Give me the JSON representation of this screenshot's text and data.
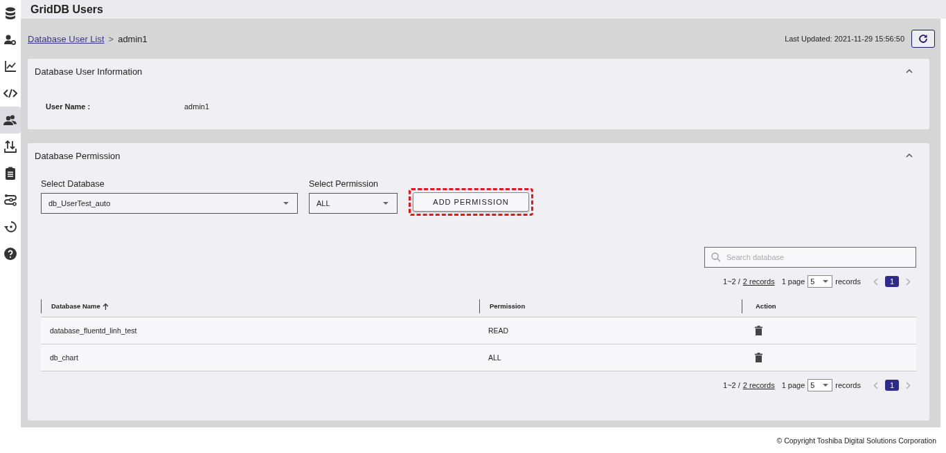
{
  "sidebar": {
    "items": [
      {
        "selected": false
      },
      {
        "selected": false
      },
      {
        "selected": false
      },
      {
        "selected": false
      },
      {
        "selected": true
      },
      {
        "selected": false
      },
      {
        "selected": false
      },
      {
        "selected": false
      },
      {
        "selected": false
      },
      {
        "selected": false
      }
    ]
  },
  "header": {
    "title": "GridDB Users"
  },
  "breadcrumb": {
    "link": "Database User List",
    "separator": ">",
    "current": "admin1"
  },
  "last_updated": "Last Updated: 2021-11-29 15:56:50",
  "user_info": {
    "title": "Database User Information",
    "expanded": true,
    "label": "User Name :",
    "value": "admin1"
  },
  "permission": {
    "title": "Database Permission",
    "expanded": true,
    "select_database": {
      "label": "Select Database",
      "value": "db_UserTest_auto"
    },
    "select_permission": {
      "label": "Select Permission",
      "value": "ALL"
    },
    "add_button": {
      "label": "ADD PERMISSION",
      "highlighted": true
    },
    "search": {
      "placeholder": "Search database"
    },
    "pagination": {
      "range": "1~2 /",
      "total": "2 records",
      "per_page_label": "1 page",
      "per_page": "5",
      "records": "records",
      "page": "1"
    },
    "table": {
      "columns": [
        {
          "label": "Database Name",
          "sorted": true
        },
        {
          "label": "Permission",
          "sorted": false
        },
        {
          "label": "Action",
          "sorted": false
        }
      ],
      "rows": [
        {
          "name": "database_fluentd_linh_test",
          "permission": "READ"
        },
        {
          "name": "db_chart",
          "permission": "ALL"
        }
      ]
    },
    "pagination_bottom": {
      "range": "1~2 /",
      "total": "2 records",
      "per_page_label": "1 page",
      "per_page": "5",
      "records": "records",
      "page": "1"
    }
  },
  "footer": "© Copyright Toshiba Digital Solutions Corporation"
}
